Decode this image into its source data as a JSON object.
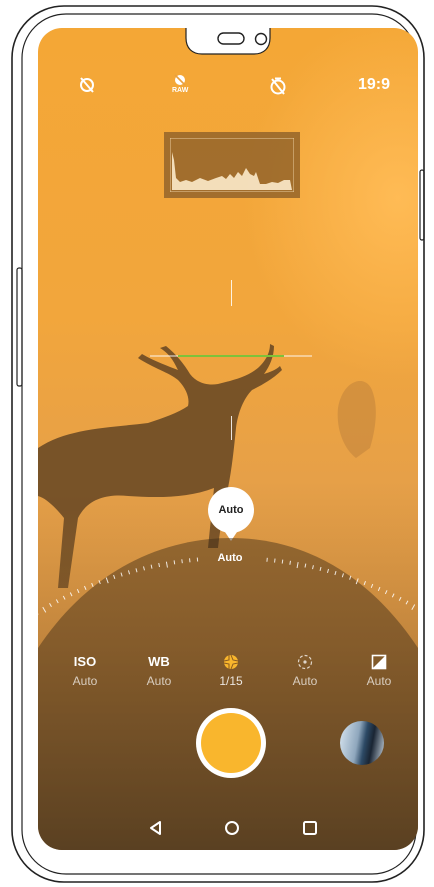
{
  "status_bar": {
    "raw_label": "RAW",
    "aspect_ratio": "19:9"
  },
  "focus_bubble": {
    "label": "Auto"
  },
  "dial": {
    "label": "Auto"
  },
  "modes": [
    {
      "title": "ISO",
      "value": "Auto",
      "icon": ""
    },
    {
      "title": "WB",
      "value": "Auto",
      "icon": ""
    },
    {
      "title": "",
      "value": "1/15",
      "icon": "aperture-icon",
      "color": "#f9b62d"
    },
    {
      "title": "",
      "value": "Auto",
      "icon": "focus-icon"
    },
    {
      "title": "",
      "value": "Auto",
      "icon": "exposure-icon"
    }
  ],
  "colors": {
    "accent": "#f9b62d",
    "level_green": "#7ec23a"
  },
  "icons": {
    "flash_off": "flash-off-icon",
    "raw": "raw-icon",
    "timer_off": "timer-off-icon",
    "back": "back-triangle-icon",
    "home": "home-circle-icon",
    "recents": "recents-square-icon"
  }
}
